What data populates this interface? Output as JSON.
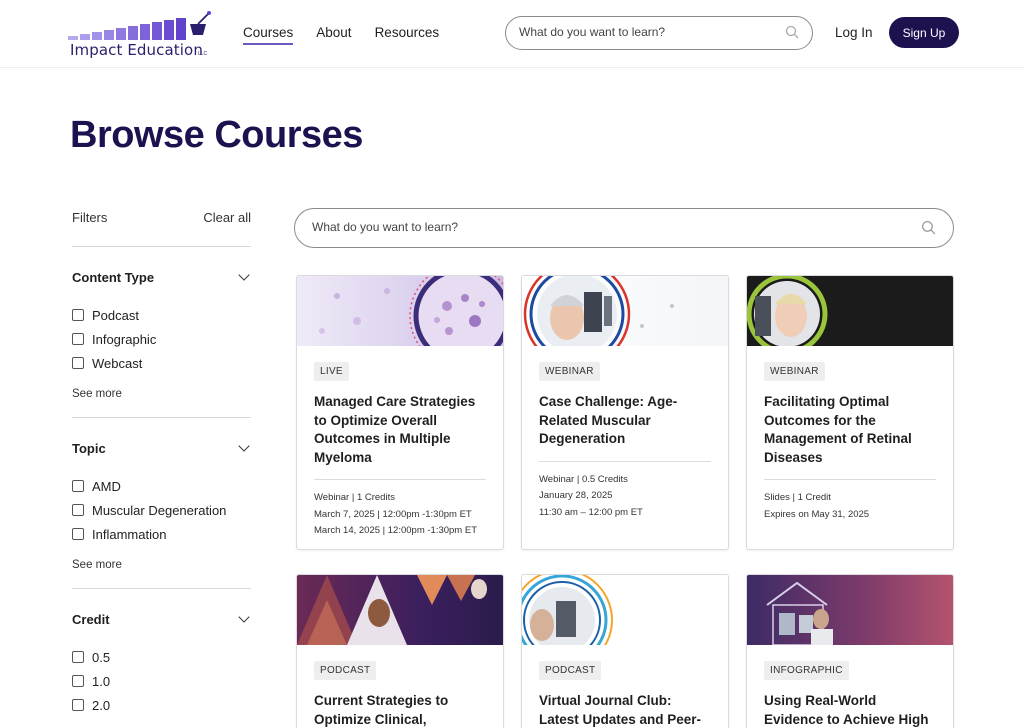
{
  "header": {
    "logo_text": "Impact Education",
    "logo_suffix": "LLC",
    "nav": [
      "Courses",
      "About",
      "Resources"
    ],
    "search_placeholder": "What do you want to learn?",
    "login_label": "Log In",
    "signup_label": "Sign Up",
    "brand_color": "#1e1150"
  },
  "page_title": "Browse Courses",
  "filters": {
    "label": "Filters",
    "clear_label": "Clear all",
    "groups": [
      {
        "title": "Content Type",
        "options": [
          "Podcast",
          "Infographic",
          "Webcast"
        ],
        "see_more": "See more"
      },
      {
        "title": "Topic",
        "options": [
          "AMD",
          "Muscular Degeneration",
          "Inflammation"
        ],
        "see_more": "See more"
      },
      {
        "title": "Credit",
        "options": [
          "0.5",
          "1.0",
          "2.0"
        ]
      }
    ]
  },
  "main_search_placeholder": "What do you want to learn?",
  "cards": [
    {
      "badge": "LIVE",
      "title": "Managed Care Strategies to Optimize Overall Outcomes in Multiple Myeloma",
      "meta": [
        "Webinar  |  1 Credits",
        "March 7, 2025  |  12:00pm -1:30pm ET",
        "March 14, 2025  |  12:00pm -1:30pm ET"
      ]
    },
    {
      "badge": "WEBINAR",
      "title": "Case Challenge: Age-Related Muscular Degeneration",
      "meta": [
        "Webinar  |  0.5 Credits",
        "January 28, 2025",
        "11:30 am – 12:00 pm ET"
      ]
    },
    {
      "badge": "WEBINAR",
      "title": "Facilitating Optimal Outcomes for the Management of Retinal Diseases",
      "meta": [
        "Slides  |  1 Credit",
        "Expires on May 31, 2025"
      ]
    },
    {
      "badge": "PODCAST",
      "title": "Current Strategies to Optimize Clinical,"
    },
    {
      "badge": "PODCAST",
      "title": "Virtual Journal Club: Latest Updates and Peer-"
    },
    {
      "badge": "INFOGRAPHIC",
      "title": "Using Real-World Evidence to Achieve High"
    }
  ]
}
